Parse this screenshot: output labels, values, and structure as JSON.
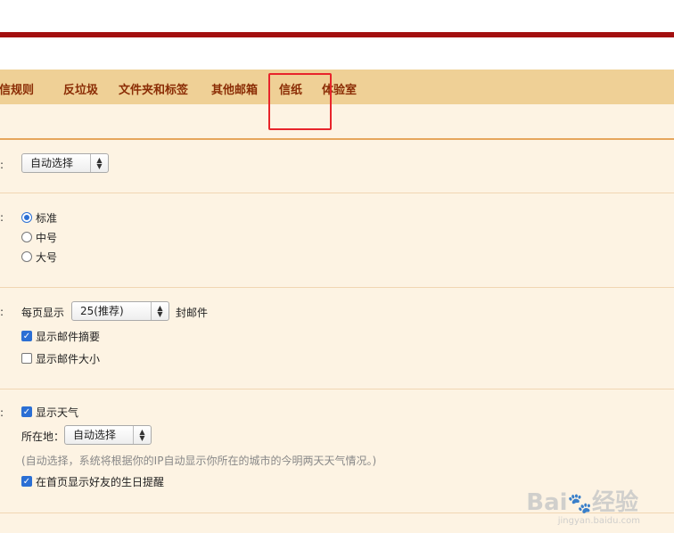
{
  "nav": {
    "tabs": [
      {
        "label": "收信规则"
      },
      {
        "label": "反垃圾"
      },
      {
        "label": "文件夹和标签"
      },
      {
        "label": "其他邮箱"
      },
      {
        "label": "信纸"
      },
      {
        "label": "体验室"
      }
    ]
  },
  "section1": {
    "colon": ":",
    "select_value": "自动选择"
  },
  "section2": {
    "colon": ":",
    "options": [
      {
        "label": "标准",
        "checked": true
      },
      {
        "label": "中号",
        "checked": false
      },
      {
        "label": "大号",
        "checked": false
      }
    ]
  },
  "section3": {
    "colon": ":",
    "per_page_prefix": "每页显示",
    "per_page_value": "25(推荐)",
    "per_page_suffix": "封邮件",
    "checks": [
      {
        "label": "显示邮件摘要",
        "checked": true
      },
      {
        "label": "显示邮件大小",
        "checked": false
      }
    ]
  },
  "section4": {
    "colon": ":",
    "weather_label": "显示天气",
    "weather_checked": true,
    "location_label": "所在地：",
    "location_value": "自动选择",
    "hint": "(自动选择，系统将根据你的IP自动显示你所在的城市的今明两天天气情况。)",
    "birthday_label": "在首页显示好友的生日提醒",
    "birthday_checked": true
  },
  "watermark": {
    "main_left": "Bai",
    "main_right": "经验",
    "sub": "jingyan.baidu.com"
  },
  "colors": {
    "tab_bg": "#efd096",
    "tab_text": "#8b2d05",
    "content_bg": "#fdf3e3",
    "red_bar": "#a30f0f",
    "highlight_box": "#e8242b",
    "checkbox_blue": "#2b6fd4"
  }
}
